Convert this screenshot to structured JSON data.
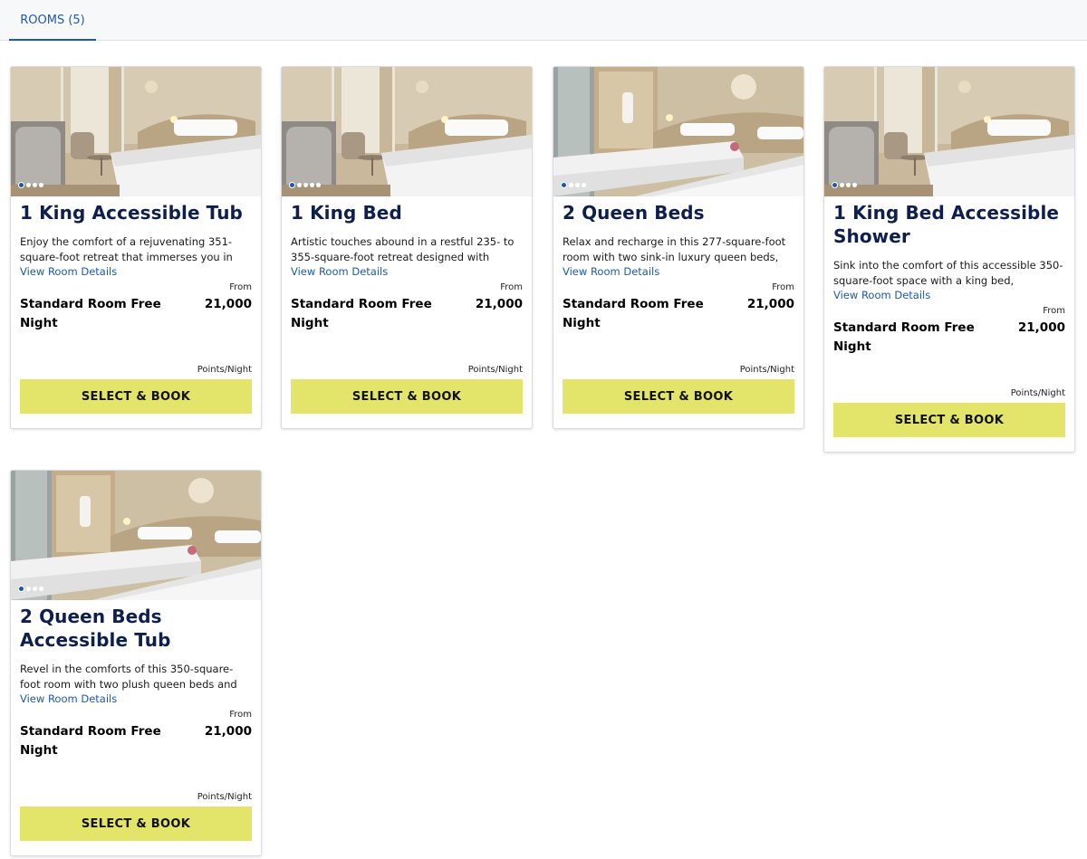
{
  "tabs": {
    "rooms_label": "ROOMS (5)"
  },
  "colors": {
    "accent": "#1e5aa8",
    "title": "#0f1f4d",
    "button": "#e3e56a"
  },
  "rooms": [
    {
      "title": "1 King Accessible Tub",
      "description": "Enjoy the comfort of a rejuvenating 351-square-foot retreat that immerses you in the…",
      "details_link": "View Room Details",
      "rate_name": "Standard Room Free Night",
      "from_label": "From",
      "points": "21,000",
      "points_unit": "Points/Night",
      "button": "SELECT & BOOK",
      "photo": "king-room-photo",
      "image_count": 4
    },
    {
      "title": "1 King Bed",
      "description": "Artistic touches abound in a restful 235- to 355-square-foot retreat designed with natura…",
      "details_link": "View Room Details",
      "rate_name": "Standard Room Free Night",
      "from_label": "From",
      "points": "21,000",
      "points_unit": "Points/Night",
      "button": "SELECT & BOOK",
      "photo": "king-room-photo",
      "image_count": 5
    },
    {
      "title": "2 Queen Beds",
      "description": "Relax and recharge in this 277-square-foot room with two sink-in luxury queen beds, a…",
      "details_link": "View Room Details",
      "rate_name": "Standard Room Free Night",
      "from_label": "From",
      "points": "21,000",
      "points_unit": "Points/Night",
      "button": "SELECT & BOOK",
      "photo": "queen-room-photo",
      "image_count": 4
    },
    {
      "title": "1 King Bed Accessible Shower",
      "description": "Sink into the comfort of this accessible 350-square-foot space with a king bed, luxurious…",
      "details_link": "View Room Details",
      "rate_name": "Standard Room Free Night",
      "from_label": "From",
      "points": "21,000",
      "points_unit": "Points/Night",
      "button": "SELECT & BOOK",
      "photo": "king-room-photo",
      "image_count": 4
    },
    {
      "title": "2 Queen Beds Accessible Tub",
      "description": "Revel in the comforts of this 350-square-foot room with two plush queen beds and an…",
      "details_link": "View Room Details",
      "rate_name": "Standard Room Free Night",
      "from_label": "From",
      "points": "21,000",
      "points_unit": "Points/Night",
      "button": "SELECT & BOOK",
      "photo": "queen-room-photo",
      "image_count": 4
    }
  ]
}
